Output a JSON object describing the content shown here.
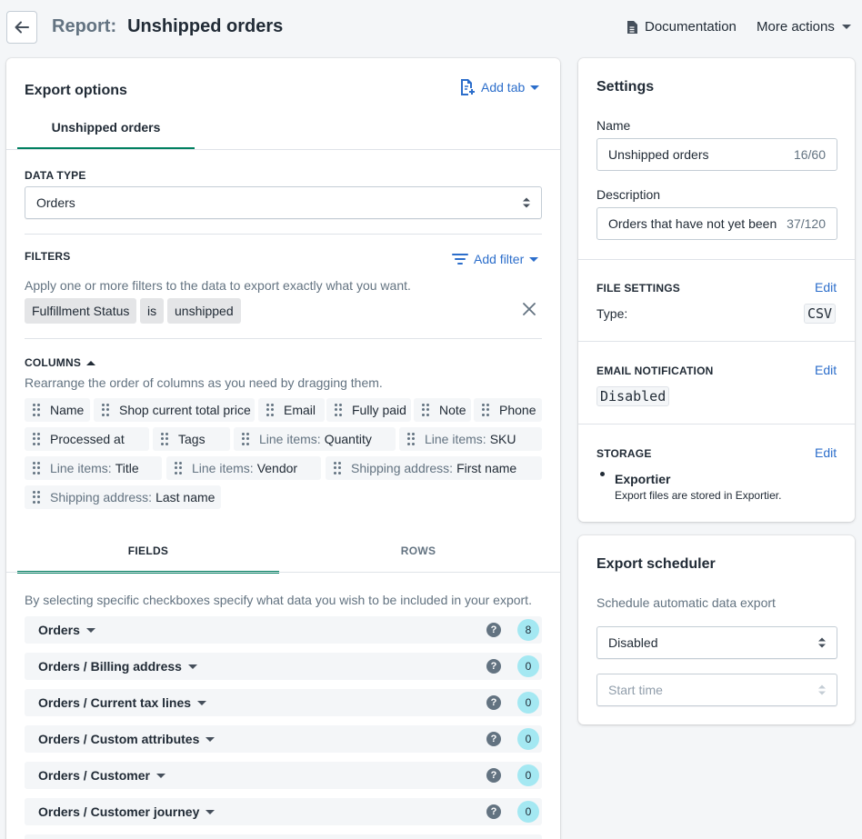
{
  "header": {
    "title_prefix": "Report:",
    "title": "Unshipped orders",
    "documentation": "Documentation",
    "more_actions": "More actions"
  },
  "export_options": {
    "title": "Export options",
    "add_tab": "Add tab",
    "tab": "Unshipped orders",
    "data_type_label": "DATA TYPE",
    "data_type_value": "Orders",
    "filters_label": "FILTERS",
    "add_filter": "Add filter",
    "filters_help": "Apply one or more filters to the data to export exactly what you want.",
    "filter": {
      "field": "Fulfillment Status",
      "op": "is",
      "value": "unshipped"
    },
    "columns_label": "COLUMNS",
    "columns_help": "Rearrange the order of columns as you need by dragging them.",
    "columns": [
      {
        "prefix": "",
        "name": "Name"
      },
      {
        "prefix": "",
        "name": "Shop current total price"
      },
      {
        "prefix": "",
        "name": "Email"
      },
      {
        "prefix": "",
        "name": "Fully paid"
      },
      {
        "prefix": "",
        "name": "Note"
      },
      {
        "prefix": "",
        "name": "Phone"
      },
      {
        "prefix": "",
        "name": "Processed at"
      },
      {
        "prefix": "",
        "name": "Tags"
      },
      {
        "prefix": "Line items:",
        "name": "Quantity"
      },
      {
        "prefix": "Line items:",
        "name": "SKU"
      },
      {
        "prefix": "Line items:",
        "name": "Title"
      },
      {
        "prefix": "Line items:",
        "name": "Vendor"
      },
      {
        "prefix": "Shipping address:",
        "name": "First name"
      },
      {
        "prefix": "Shipping address:",
        "name": "Last name"
      }
    ],
    "tabs2": [
      "FIELDS",
      "ROWS"
    ],
    "fields_help": "By selecting specific checkboxes specify what data you wish to be included in your export.",
    "field_groups": [
      {
        "label": "Orders",
        "count": "8"
      },
      {
        "label": "Orders / Billing address",
        "count": "0"
      },
      {
        "label": "Orders / Current tax lines",
        "count": "0"
      },
      {
        "label": "Orders / Custom attributes",
        "count": "0"
      },
      {
        "label": "Orders / Customer",
        "count": "0"
      },
      {
        "label": "Orders / Customer journey",
        "count": "0"
      }
    ]
  },
  "settings": {
    "title": "Settings",
    "name_label": "Name",
    "name_value": "Unshipped orders",
    "name_count": "16/60",
    "description_label": "Description",
    "description_value": "Orders that have not yet been shipped",
    "description_count": "37/120",
    "file_settings_label": "FILE SETTINGS",
    "edit": "Edit",
    "type_label": "Type:",
    "type_value": "CSV",
    "email_label": "EMAIL NOTIFICATION",
    "email_value": "Disabled",
    "storage_label": "STORAGE",
    "storage_name": "Exportier",
    "storage_desc": "Export files are stored in Exportier."
  },
  "scheduler": {
    "title": "Export scheduler",
    "help": "Schedule automatic data export",
    "value": "Disabled",
    "start_time_placeholder": "Start time"
  },
  "colors": {
    "accent": "#008060",
    "link": "#2c6ecb",
    "badge": "#a4e8f2"
  }
}
